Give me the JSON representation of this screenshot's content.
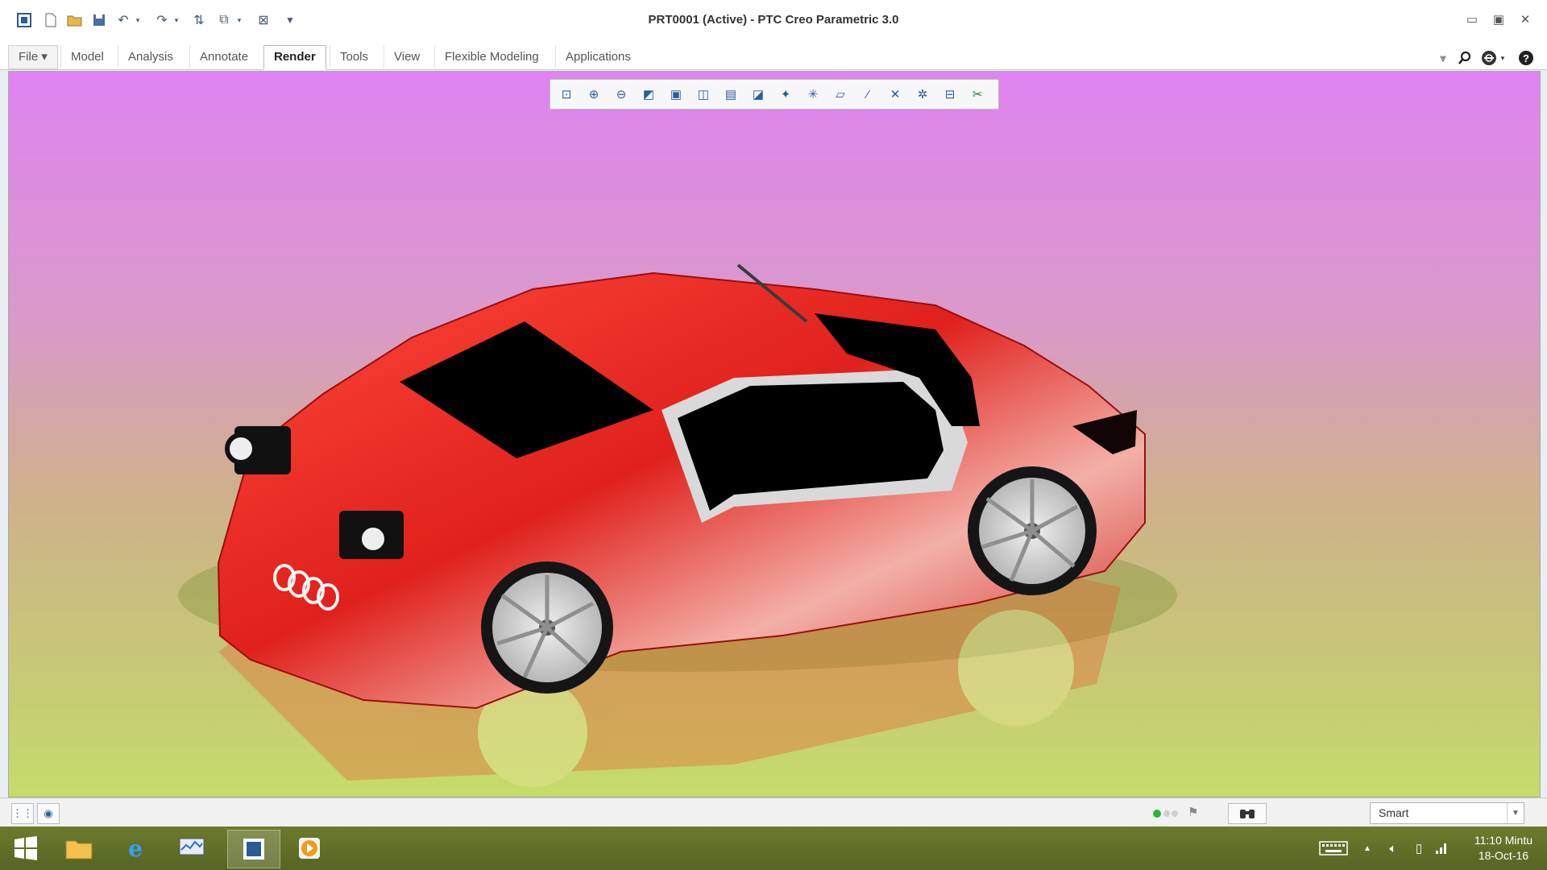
{
  "window": {
    "title": "PRT0001 (Active) - PTC Creo Parametric 3.0",
    "quick_access": [
      "app-menu-icon",
      "new-icon",
      "open-icon",
      "save-icon",
      "undo-icon",
      "undo-dropdown-icon",
      "redo-icon",
      "redo-dropdown-icon",
      "regenerate-icon",
      "windows-icon",
      "windows-dropdown-icon",
      "close-window-icon",
      "customize-icon"
    ],
    "controls": {
      "minimize": "▭",
      "maximize": "▣",
      "close": "✕"
    }
  },
  "ribbon": {
    "tabs": [
      {
        "label": "File ▾",
        "active": false
      },
      {
        "label": "Model",
        "active": false
      },
      {
        "label": "Analysis",
        "active": false
      },
      {
        "label": "Annotate",
        "active": false
      },
      {
        "label": "Render",
        "active": true
      },
      {
        "label": "Tools",
        "active": false
      },
      {
        "label": "View",
        "active": false
      },
      {
        "label": "Flexible Modeling",
        "active": false
      },
      {
        "label": "Applications",
        "active": false
      }
    ],
    "right_icons": [
      "minimize-ribbon-icon",
      "search-icon",
      "community-icon",
      "help-icon"
    ]
  },
  "graphics_toolbar": {
    "buttons": [
      "refit-icon",
      "zoom-in-icon",
      "zoom-out-icon",
      "repaint-icon",
      "display-style-icon",
      "saved-orientations-icon",
      "view-manager-icon",
      "perspective-icon",
      "spin-center-icon",
      "datum-display-icon",
      "plane-display-icon",
      "axis-display-icon",
      "point-display-icon",
      "csys-display-icon",
      "annotation-display-icon",
      "appearance-icon"
    ]
  },
  "viewport": {
    "background_top": "#df83f1",
    "background_bottom": "#c5dc6a",
    "model": {
      "body_color": "#e0201c",
      "window_color": "#000000",
      "wheel_color": "#d8d8d8",
      "logo_rings": 4
    }
  },
  "status_bar": {
    "left_icons": [
      "model-tree-toggle-icon",
      "browser-toggle-icon"
    ],
    "filter": {
      "value": "Smart"
    }
  },
  "taskbar": {
    "items": [
      "start-icon",
      "file-explorer-icon",
      "internet-explorer-icon",
      "performance-monitor-icon",
      "creo-icon",
      "media-player-icon"
    ],
    "tray": [
      "keyboard-icon",
      "show-hidden-icon",
      "volume-icon",
      "battery-icon",
      "network-icon"
    ],
    "clock": {
      "time": "11:10 Mintu",
      "date": "18-Oct-16"
    }
  }
}
